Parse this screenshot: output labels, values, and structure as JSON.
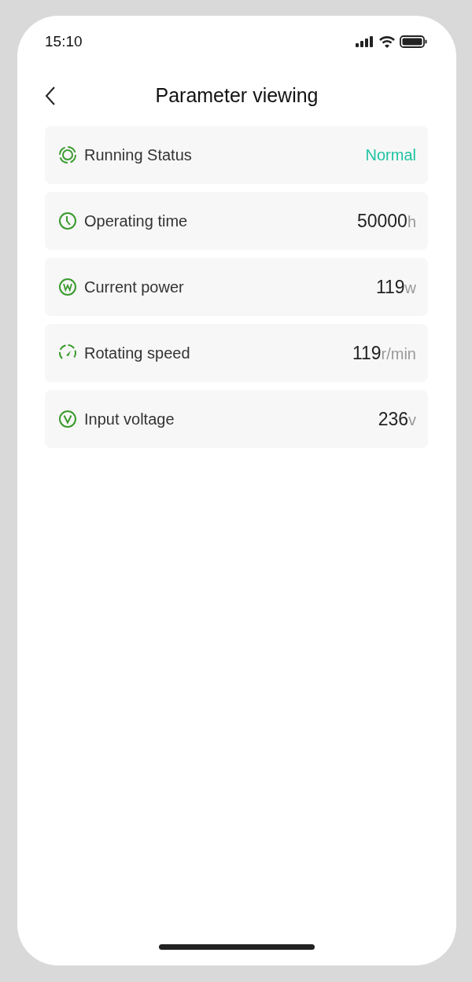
{
  "status_bar": {
    "time": "15:10"
  },
  "header": {
    "title": "Parameter viewing"
  },
  "parameters": [
    {
      "kind": "status",
      "label": "Running Status",
      "value": "Normal"
    },
    {
      "kind": "measure",
      "label": "Operating time",
      "value": "50000",
      "unit": "h"
    },
    {
      "kind": "measure",
      "label": "Current power",
      "value": "119",
      "unit": "w"
    },
    {
      "kind": "measure",
      "label": "Rotating speed",
      "value": "119",
      "unit": "r/min"
    },
    {
      "kind": "measure",
      "label": "Input voltage",
      "value": "236",
      "unit": "v"
    }
  ]
}
